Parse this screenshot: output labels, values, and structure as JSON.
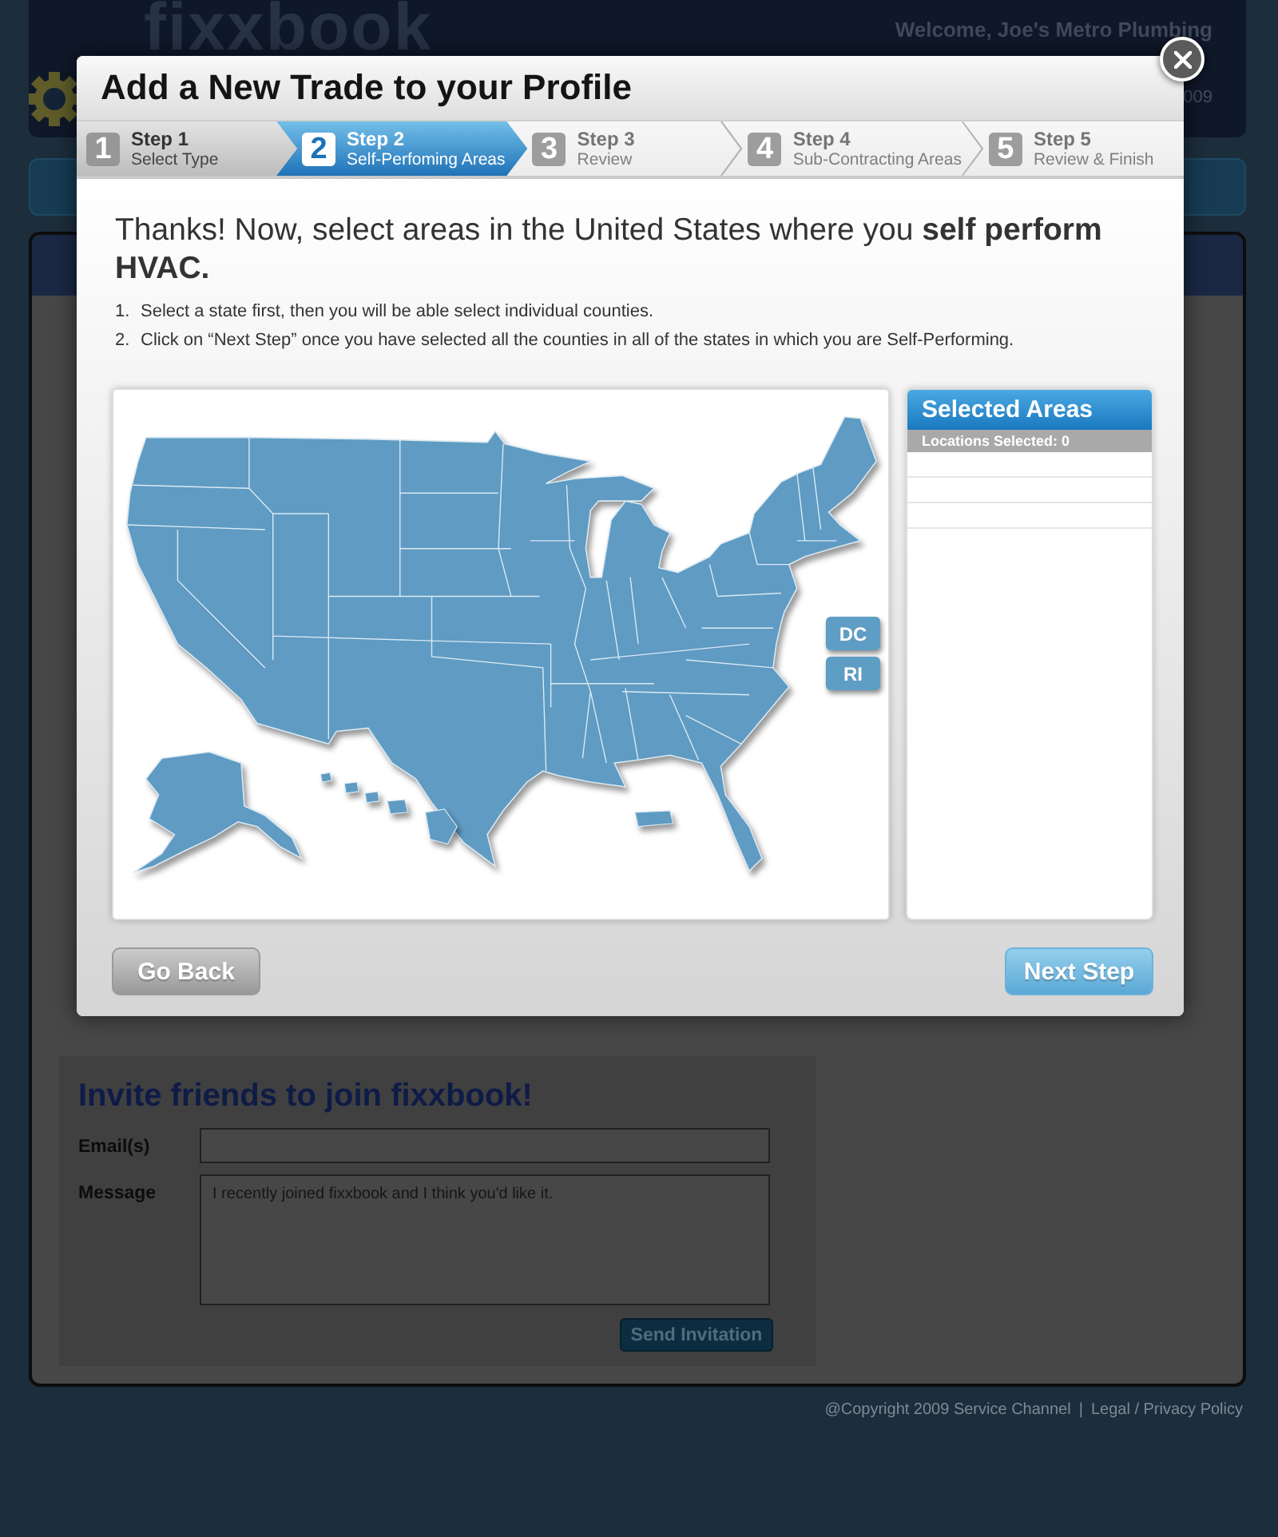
{
  "site_header": {
    "logo": "fixxbook",
    "welcome": "Welcome, Joe's Metro Plumbing",
    "date_fragment": "009"
  },
  "modal": {
    "title": "Add a New Trade to your Profile",
    "steps": [
      {
        "number": "1",
        "title": "Step 1",
        "subtitle": "Select Type",
        "selected": false,
        "completed": true
      },
      {
        "number": "2",
        "title": "Step 2",
        "subtitle": "Self-Perfoming Areas",
        "selected": true,
        "completed": false
      },
      {
        "number": "3",
        "title": "Step 3",
        "subtitle": "Review",
        "selected": false,
        "completed": false
      },
      {
        "number": "4",
        "title": "Step 4",
        "subtitle": "Sub-Contracting Areas",
        "selected": false,
        "completed": false
      },
      {
        "number": "5",
        "title": "Step 5",
        "subtitle": "Review & Finish",
        "selected": false,
        "completed": false
      }
    ],
    "heading": "Thanks! Now, select areas in the United States where you **self perform HVAC.**",
    "instructions": [
      {
        "marker": "1.",
        "text": "Select a state first, then you will be able select individual counties."
      },
      {
        "marker": "2.",
        "text": "Click on “Next Step” once you have selected all the counties in all of the states in which you are Self-Performing."
      }
    ],
    "map": {
      "small_state_buttons": [
        "DC",
        "RI"
      ]
    },
    "selected_areas": {
      "title": "Selected Areas",
      "count_label": "Locations Selected: 0"
    },
    "buttons": [
      {
        "label": "Go Back",
        "kind": "secondary"
      },
      {
        "label": "Next Step",
        "kind": "primary"
      }
    ]
  },
  "invite": {
    "title": "Invite friends to join fixxbook!",
    "fields": [
      {
        "label": "Email(s)",
        "kind": "input"
      },
      {
        "label": "Message",
        "kind": "textarea",
        "value": "I recently joined fixxbook and I think you'd like it."
      }
    ],
    "button": "Send Invitation"
  },
  "footer": {
    "copyright": "@Copyright 2009 Service Channel",
    "separator": "|",
    "link": "Legal / Privacy Policy"
  }
}
